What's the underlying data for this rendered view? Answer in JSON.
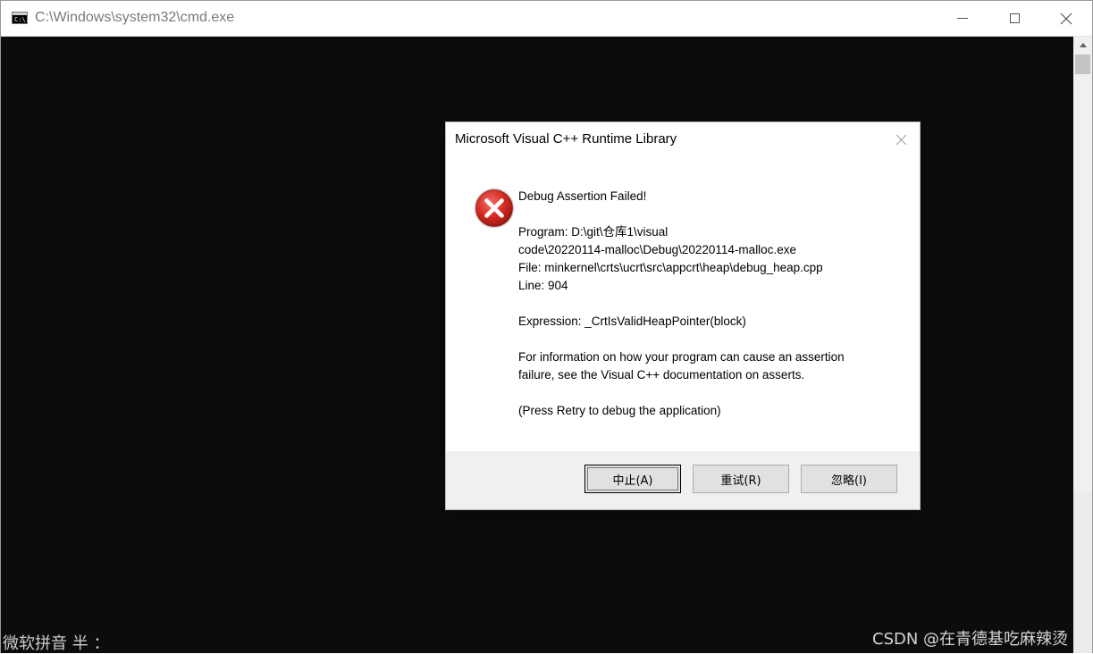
{
  "window": {
    "title": "C:\\Windows\\system32\\cmd.exe",
    "icon": "cmd-icon",
    "icon_text": "C:\\."
  },
  "ime": {
    "status": "微软拼音 半 ："
  },
  "watermark": {
    "text": "CSDN @在青德基吃麻辣烫"
  },
  "dialog": {
    "title": "Microsoft Visual C++ Runtime Library",
    "icon": "error-icon",
    "lines": {
      "heading": "Debug Assertion Failed!",
      "program1": "Program: D:\\git\\仓库1\\visual",
      "program2": "code\\20220114-malloc\\Debug\\20220114-malloc.exe",
      "file": "File: minkernel\\crts\\ucrt\\src\\appcrt\\heap\\debug_heap.cpp",
      "line": "Line: 904",
      "expression": "Expression: _CrtIsValidHeapPointer(block)",
      "info1": "For information on how your program can cause an assertion",
      "info2": "failure, see the Visual C++ documentation on asserts.",
      "press": "(Press Retry to debug the application)"
    },
    "buttons": {
      "abort": "中止(A)",
      "retry": "重试(R)",
      "ignore": "忽略(I)"
    }
  },
  "colors": {
    "console_bg": "#0c0c0c",
    "error_red": "#c42b1c"
  }
}
